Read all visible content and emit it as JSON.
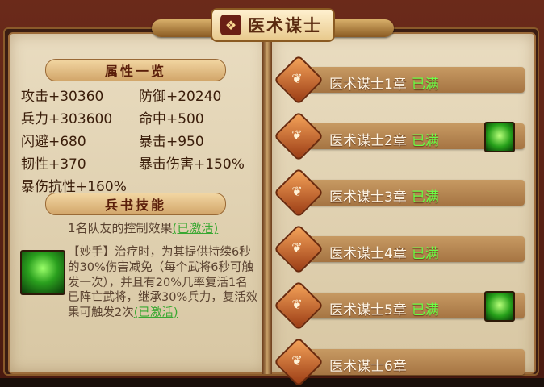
{
  "window": {
    "title": "医术谋士"
  },
  "attributes": {
    "header": "属性一览",
    "rows": [
      [
        "攻击+30360",
        "防御+20240"
      ],
      [
        "兵力+303600",
        "命中+500"
      ],
      [
        "闪避+680",
        "暴击+950"
      ],
      [
        "韧性+370",
        "暴击伤害+150%"
      ],
      [
        "暴伤抗性+160%",
        ""
      ]
    ]
  },
  "skills": {
    "header": "兵书技能",
    "effect_text": "1名队友的控制效果",
    "effect_status": "(已激活)",
    "skill_desc": "【妙手】治疗时，为其提供持续6秒的30%伤害减免（每个武将6秒可触发一次），并且有20%几率复活1名已阵亡武将，继承30%兵力，复活效果可触发2次",
    "skill_status": "(已激活)"
  },
  "chapters": [
    {
      "name": "医术谋士1章",
      "status": "已满",
      "has_reward": false
    },
    {
      "name": "医术谋士2章",
      "status": "已满",
      "has_reward": true
    },
    {
      "name": "医术谋士3章",
      "status": "已满",
      "has_reward": false
    },
    {
      "name": "医术谋士4章",
      "status": "已满",
      "has_reward": false
    },
    {
      "name": "医术谋士5章",
      "status": "已满",
      "has_reward": true
    },
    {
      "name": "医术谋士6章",
      "status": "",
      "has_reward": false
    }
  ],
  "colors": {
    "active_green": "#3aa832",
    "status_green": "#6bff46"
  }
}
